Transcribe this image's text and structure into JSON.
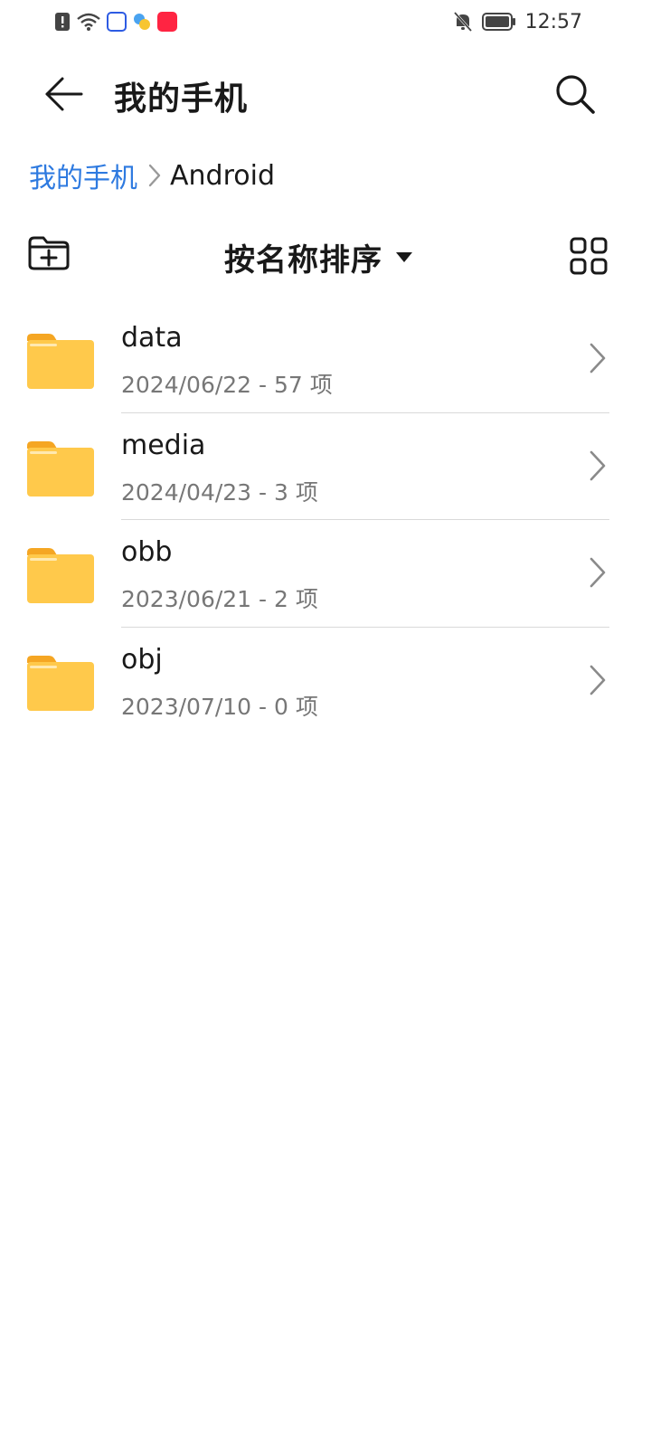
{
  "status_bar": {
    "time": "12:57",
    "left_icons": [
      "alert-icon",
      "wifi-icon",
      "app-icon-baidu",
      "app-icon-pinwheel",
      "app-icon-xiaohongshu"
    ],
    "right_icons": [
      "bell-off-icon",
      "battery-icon"
    ]
  },
  "app_bar": {
    "title": "我的手机"
  },
  "breadcrumb": {
    "root": "我的手机",
    "current": "Android"
  },
  "toolbar": {
    "sort_label": "按名称排序"
  },
  "files": [
    {
      "name": "data",
      "meta": "2024/06/22 - 57 项"
    },
    {
      "name": "media",
      "meta": "2024/04/23 - 3 项"
    },
    {
      "name": "obb",
      "meta": "2023/06/21 - 2 项"
    },
    {
      "name": "obj",
      "meta": "2023/07/10 - 0 项"
    }
  ],
  "colors": {
    "accent": "#2e7ae0",
    "folder": "#ffc94b",
    "folder_tab": "#f5a623"
  }
}
